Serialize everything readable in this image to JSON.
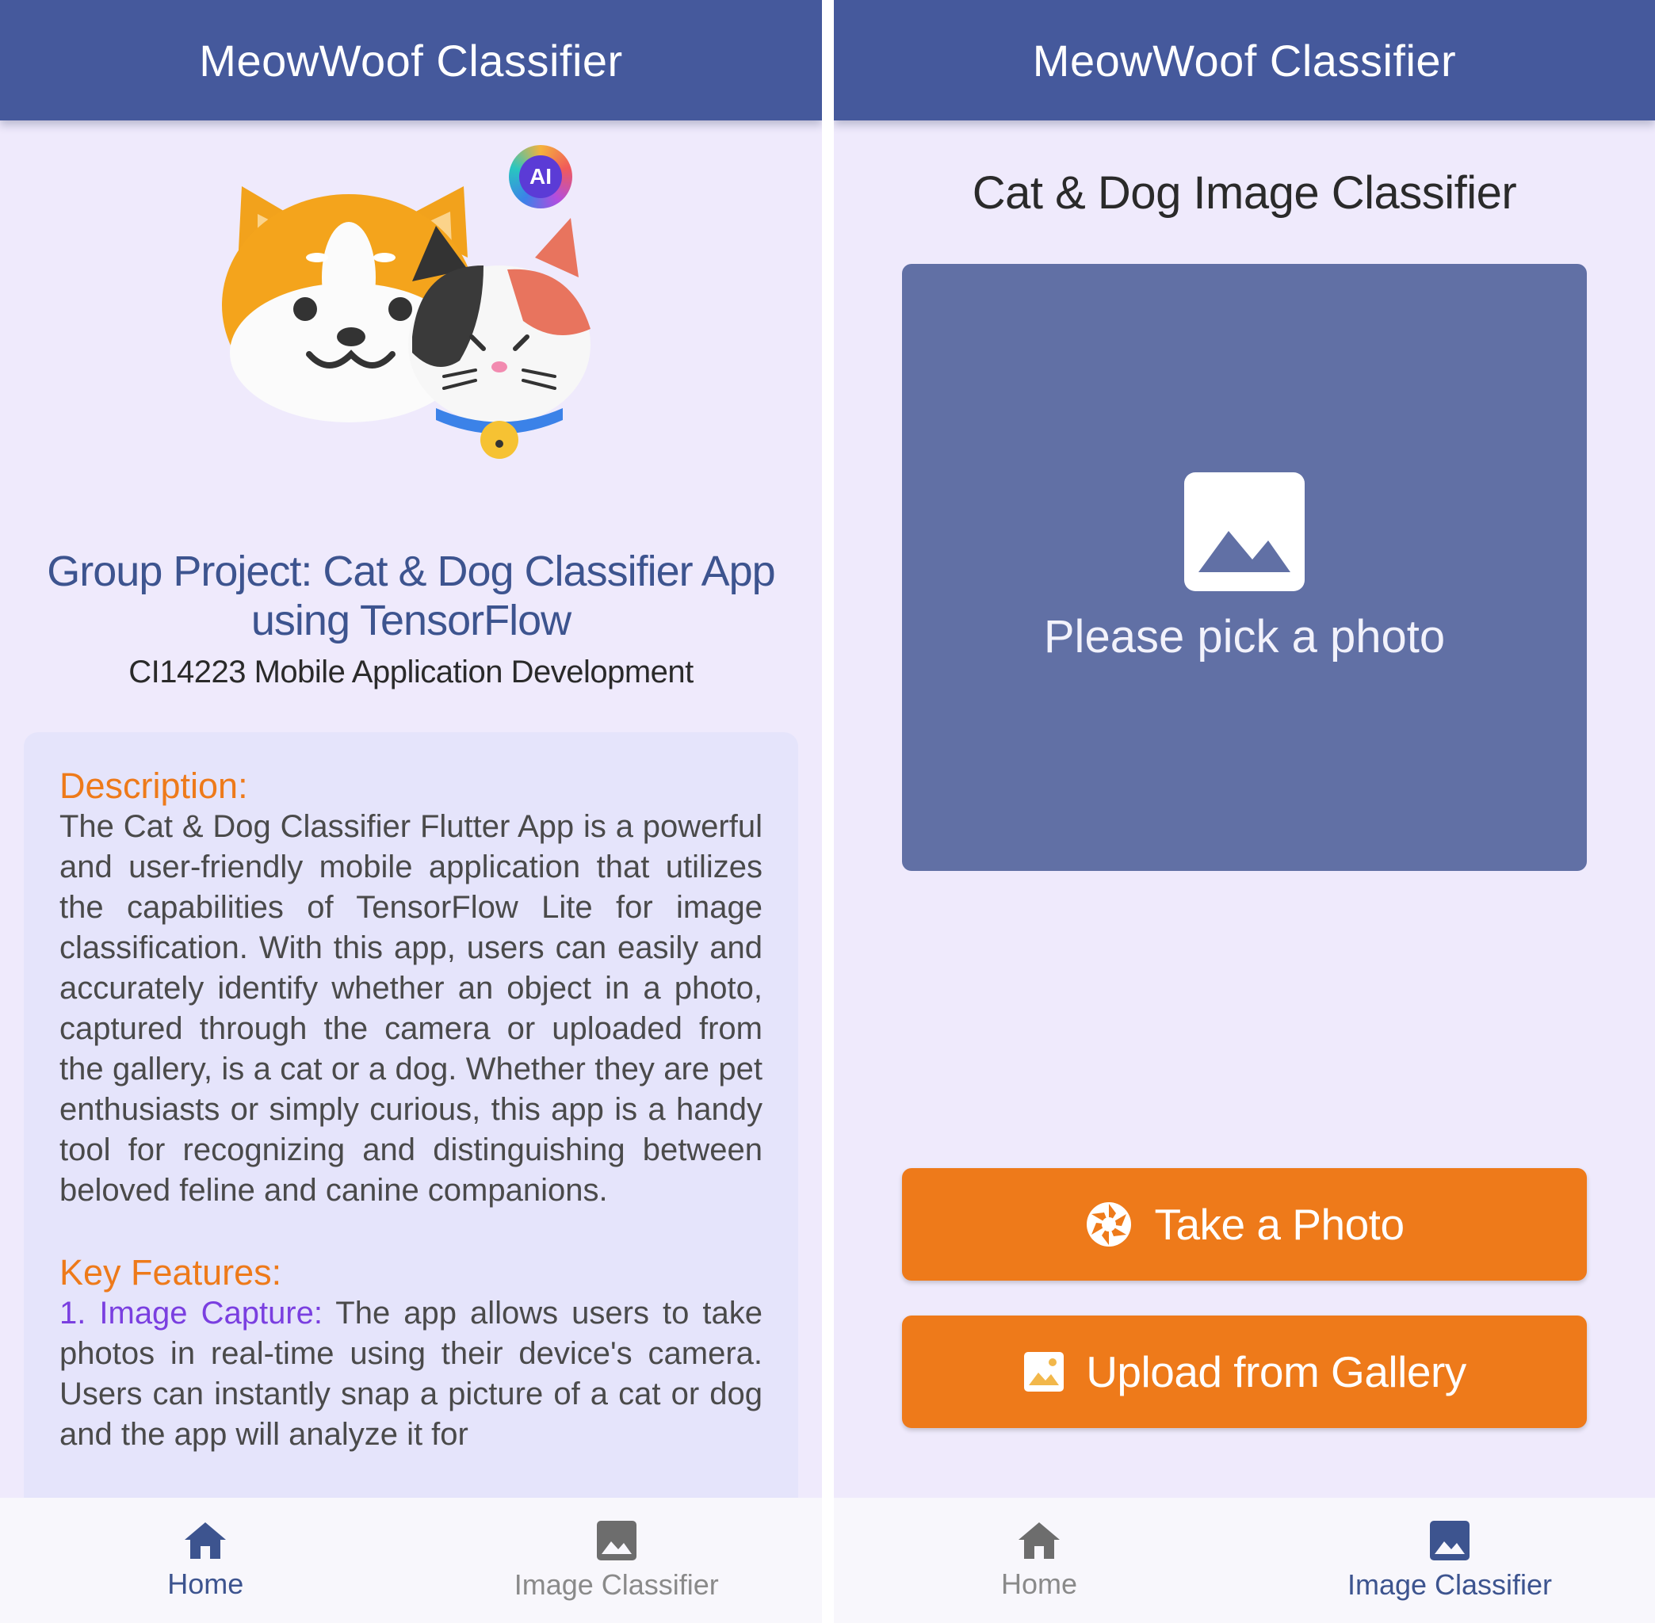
{
  "colors": {
    "appbar": "#45599c",
    "background": "#efeafc",
    "card": "#e5e4fb",
    "accent_orange": "#ee7a1a",
    "photo_area": "#6170a5",
    "nav_active": "#3d548f",
    "nav_inactive": "#8a8a8a"
  },
  "left_screen": {
    "appbar": {
      "title": "MeowWoof Classifier"
    },
    "hero": {
      "ai_badge": "AI",
      "icon": "cat-dog-mascot-icon"
    },
    "project_title": "Group Project: Cat & Dog Classifier App using TensorFlow",
    "course": "CI14223 Mobile Application Development",
    "description": {
      "heading": "Description:",
      "text": "The Cat & Dog Classifier Flutter App is a powerful and user-friendly mobile application that utilizes the capabilities of TensorFlow Lite for image classification. With this app, users can easily and accurately identify whether an object in a photo, captured through the camera or uploaded from the gallery, is a cat or a dog. Whether they are pet enthusiasts or simply curious, this app is a handy tool for recognizing and distinguishing between beloved feline and canine companions."
    },
    "features": {
      "heading": "Key Features:",
      "items": [
        {
          "title": "1. Image Capture:",
          "text": " The app allows users to take photos in real-time using their device's camera. Users can instantly snap a picture of a cat or dog and the app will analyze it for"
        }
      ]
    },
    "nav": [
      {
        "label": "Home",
        "icon": "home-icon",
        "active": true
      },
      {
        "label": "Image Classifier",
        "icon": "image-icon",
        "active": false
      }
    ]
  },
  "right_screen": {
    "appbar": {
      "title": "MeowWoof Classifier"
    },
    "subtitle": "Cat & Dog Image Classifier",
    "placeholder": {
      "text": "Please pick a photo",
      "icon": "image-placeholder-icon"
    },
    "buttons": {
      "take_photo": {
        "label": "Take a Photo",
        "icon": "camera-shutter-icon"
      },
      "upload_gallery": {
        "label": "Upload from Gallery",
        "icon": "gallery-icon"
      }
    },
    "nav": [
      {
        "label": "Home",
        "icon": "home-icon",
        "active": false
      },
      {
        "label": "Image Classifier",
        "icon": "image-icon",
        "active": true
      }
    ]
  }
}
